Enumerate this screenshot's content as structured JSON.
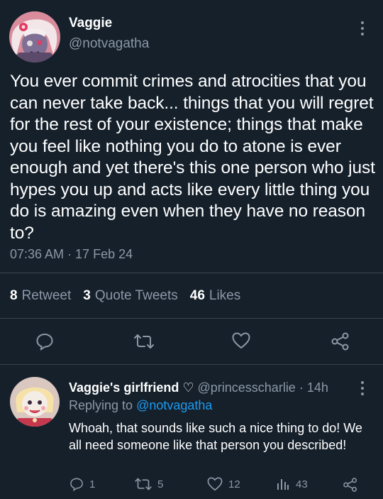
{
  "tweet": {
    "author_name": "Vaggie",
    "author_handle": "@notvagatha",
    "text": "You ever commit crimes and atrocities that you can never take back... things that you will regret for the rest of your existence; things that make you feel like nothing you do to atone is ever enough and yet there's this one person who just hypes you up and acts like every little thing you do is amazing even when they have no reason to?",
    "timestamp": "07:36 AM · 17 Feb 24",
    "stats": {
      "retweets_count": "8",
      "retweets_label": "Retweet",
      "quotes_count": "3",
      "quotes_label": "Quote Tweets",
      "likes_count": "46",
      "likes_label": "Likes"
    },
    "actions": [
      "reply-icon",
      "retweet-icon",
      "like-icon",
      "share-icon"
    ]
  },
  "reply": {
    "author_name": "Vaggie's girlfriend",
    "heart_symbol": "♡",
    "author_handle": "@princesscharlie",
    "time": "· 14h",
    "replying_prefix": "Replying to",
    "replying_handle": "@notvagatha",
    "text": "Whoah, that sounds like such a nice thing to do! We all need someone like that person you described!",
    "reply_count": "1",
    "retweet_count": "5",
    "like_count": "12",
    "views_count": "43"
  },
  "colors": {
    "background": "#15202b",
    "muted": "#8b98a5",
    "link": "#1d9bf0",
    "divider": "#38444d"
  }
}
